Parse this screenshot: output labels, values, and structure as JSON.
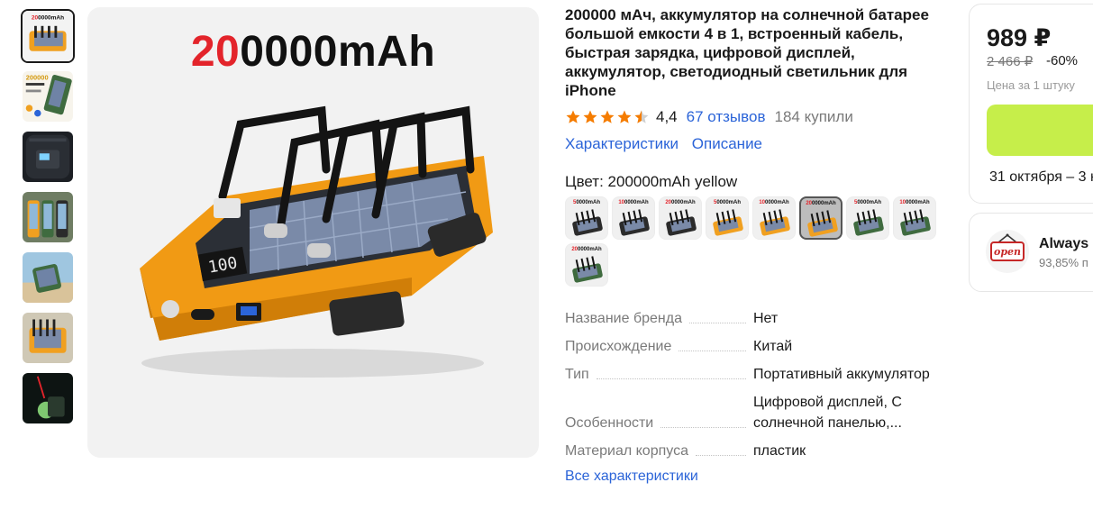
{
  "gallery": {
    "thumbnails": [
      {
        "name": "thumb-1",
        "active": true
      },
      {
        "name": "thumb-2",
        "active": false
      },
      {
        "name": "thumb-3",
        "active": false
      },
      {
        "name": "thumb-4",
        "active": false
      },
      {
        "name": "thumb-5",
        "active": false
      },
      {
        "name": "thumb-6",
        "active": false
      },
      {
        "name": "thumb-7",
        "active": false
      }
    ],
    "hero_text_red": "20",
    "hero_text_black": "0000mAh"
  },
  "product": {
    "title": "200000 мАч, аккумулятор на солнечной батарее большой емкости 4 в 1, встроенный кабель, быстрая зарядка, цифровой дисплей, аккумулятор, светодиодный светильник для iPhone",
    "rating": "4,4",
    "reviews": "67 отзывов",
    "bought": "184 купили",
    "link_specs": "Характеристики",
    "link_description": "Описание",
    "color_label": "Цвет: 200000mAh yellow",
    "swatches": [
      {
        "red": "5",
        "black": "0000mAh",
        "color": "#2b2b2b"
      },
      {
        "red": "10",
        "black": "0000mAh",
        "color": "#2b2b2b"
      },
      {
        "red": "20",
        "black": "0000mAh",
        "color": "#2b2b2b"
      },
      {
        "red": "5",
        "black": "0000mAh",
        "color": "#f0a020"
      },
      {
        "red": "10",
        "black": "0000mAh",
        "color": "#f0a020"
      },
      {
        "red": "20",
        "black": "0000mAh",
        "color": "#f0a020"
      },
      {
        "red": "5",
        "black": "0000mAh",
        "color": "#3f6b3f"
      },
      {
        "red": "10",
        "black": "0000mAh",
        "color": "#3f6b3f"
      },
      {
        "red": "20",
        "black": "0000mAh",
        "color": "#3f6b3f"
      }
    ],
    "active_swatch": 5,
    "specs": [
      {
        "key": "Название бренда",
        "value": "Нет"
      },
      {
        "key": "Происхождение",
        "value": "Китай"
      },
      {
        "key": "Тип",
        "value": "Портативный аккумулятор"
      },
      {
        "key": "Особенности",
        "value": "Цифровой дисплей, С солнечной панелью,..."
      },
      {
        "key": "Материал корпуса",
        "value": "пластик"
      }
    ],
    "all_specs_link": "Все характеристики"
  },
  "buy_card": {
    "price": "989 ₽",
    "old_price": "2 466 ₽",
    "discount": "-60%",
    "per_unit": "Цена за 1 штуку",
    "delivery": "31 октября – 3 н"
  },
  "seller": {
    "name": "Always C",
    "rating": "93,85% п"
  },
  "colors": {
    "link": "#2b64d8",
    "star": "#f57c00",
    "buy_button": "#c6ee4a",
    "hero_red": "#e3242b"
  }
}
